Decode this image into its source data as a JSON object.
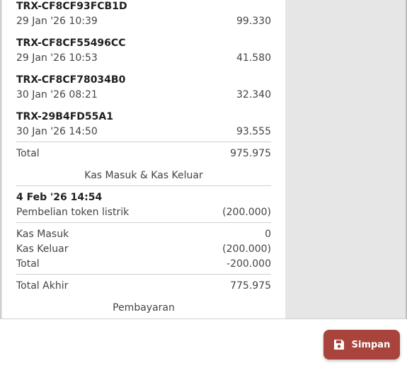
{
  "transactions": [
    {
      "id": "TRX-CF8CF93FCB1D",
      "datetime": "29 Jan '26 10:39",
      "amount": "99.330"
    },
    {
      "id": "TRX-CF8CF55496CC",
      "datetime": "29 Jan '26 10:53",
      "amount": "41.580"
    },
    {
      "id": "TRX-CF8CF78034B0",
      "datetime": "30 Jan '26 08:21",
      "amount": "32.340"
    },
    {
      "id": "TRX-29B4FD55A1",
      "datetime": "30 Jan '26 14:50",
      "amount": "93.555"
    }
  ],
  "transactions_total": {
    "label": "Total",
    "value": "975.975"
  },
  "cash_section": {
    "title": "Kas Masuk & Kas Keluar",
    "entry": {
      "datetime": "4 Feb '26 14:54",
      "description": "Pembelian token listrik",
      "amount": "(200.000)"
    },
    "kas_masuk": {
      "label": "Kas Masuk",
      "value": "0"
    },
    "kas_keluar": {
      "label": "Kas Keluar",
      "value": "(200.000)"
    },
    "total": {
      "label": "Total",
      "value": "-200.000"
    }
  },
  "grand_total": {
    "label": "Total Akhir",
    "value": "775.975"
  },
  "payment_section": {
    "title": "Pembayaran"
  },
  "actions": {
    "save_label": "Simpan",
    "save_icon": "floppy-disk-icon",
    "save_color": "#a8443b"
  }
}
